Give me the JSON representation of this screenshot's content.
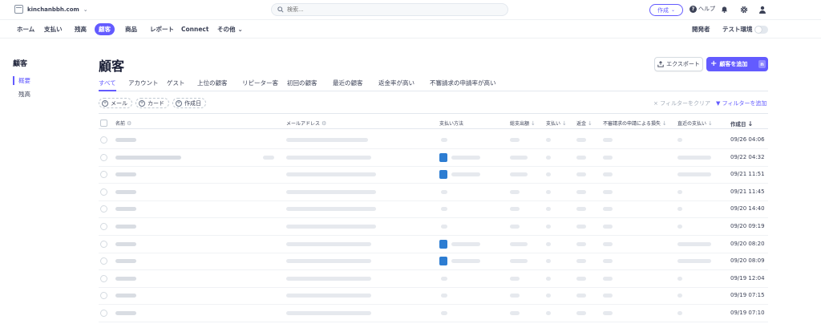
{
  "topbar": {
    "account_name": "kinchanbbh.com",
    "search_placeholder": "検索...",
    "create_label": "作成",
    "help_label": "ヘルプ"
  },
  "nav": {
    "items": [
      "ホーム",
      "支払い",
      "残高",
      "顧客",
      "商品",
      "レポート",
      "Connect",
      "その他"
    ],
    "developer_label": "開発者",
    "test_mode_label": "テスト環境"
  },
  "sidebar": {
    "title": "顧客",
    "items": [
      "概要",
      "残高"
    ]
  },
  "page": {
    "title": "顧客",
    "export_label": "エクスポート",
    "add_label": "顧客を追加",
    "add_shortcut": "n"
  },
  "tabs": [
    "すべて",
    "アカウント",
    "ゲスト",
    "上位の顧客",
    "リピーター客",
    "初回の顧客",
    "最近の顧客",
    "返金率が高い",
    "不審請求の申請率が高い"
  ],
  "filters": {
    "chips": [
      "メール",
      "カード",
      "作成日"
    ],
    "clear_label": "フィルターをクリア",
    "add_label": "フィルターを追加"
  },
  "table": {
    "headers": [
      "名前",
      "メールアドレス",
      "支払い方法",
      "総支出額",
      "支払い",
      "返金",
      "不審請求の申請による損失",
      "直近の支払い",
      "作成日"
    ],
    "rows": [
      {
        "date": "09/26 04:06",
        "card": false
      },
      {
        "date": "09/22 04:32",
        "card": true
      },
      {
        "date": "09/21 11:51",
        "card": true
      },
      {
        "date": "09/21 11:45",
        "card": false
      },
      {
        "date": "09/20 14:40",
        "card": false
      },
      {
        "date": "09/20 09:19",
        "card": false
      },
      {
        "date": "09/20 08:20",
        "card": true
      },
      {
        "date": "09/20 08:09",
        "card": true
      },
      {
        "date": "09/19 12:04",
        "card": false
      },
      {
        "date": "09/19 07:15",
        "card": false
      },
      {
        "date": "09/19 07:10",
        "card": false
      }
    ]
  },
  "colors": {
    "accent": "#635bff",
    "card_brand": "#2d7dd2"
  }
}
